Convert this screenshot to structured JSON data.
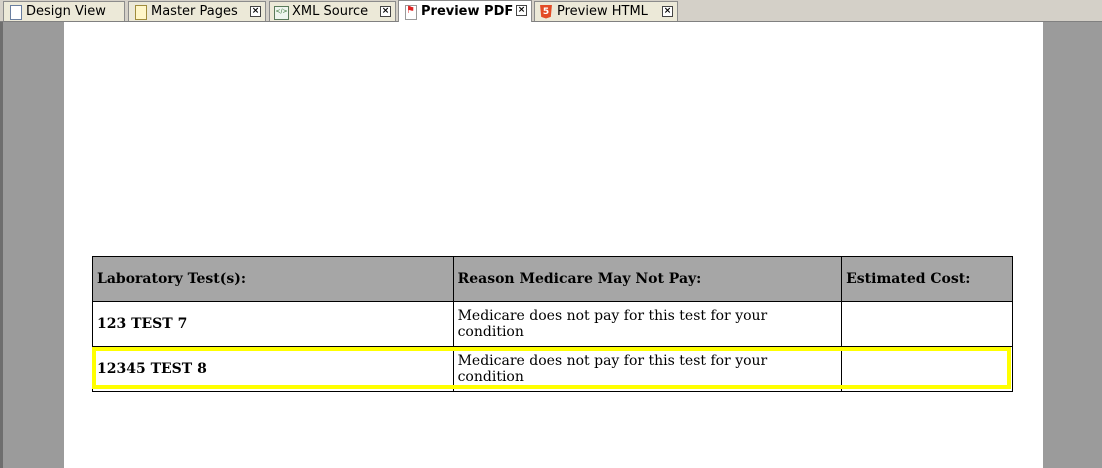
{
  "tabs": [
    {
      "label": "Design View",
      "icon": "document-icon",
      "closable": false,
      "active": false
    },
    {
      "label": "Master Pages",
      "icon": "master-pages-icon",
      "closable": true,
      "active": false
    },
    {
      "label": "XML Source",
      "icon": "xml-icon",
      "closable": true,
      "active": false
    },
    {
      "label": "Preview PDF",
      "icon": "pdf-icon",
      "closable": true,
      "active": true
    },
    {
      "label": "Preview HTML",
      "icon": "html5-icon",
      "closable": true,
      "active": false
    }
  ],
  "table": {
    "headers": [
      "Laboratory Test(s):",
      "Reason Medicare May Not Pay:",
      "Estimated Cost:"
    ],
    "rows": [
      [
        "123 TEST 7",
        "Medicare does not pay for this test for your condition",
        ""
      ],
      [
        "12345 TEST 8",
        "Medicare does not pay for this test for your condition",
        ""
      ]
    ]
  },
  "colors": {
    "header_bg": "#a6a6a6",
    "highlight": "#ffff00",
    "workspace_bg": "#9b9b9b"
  }
}
